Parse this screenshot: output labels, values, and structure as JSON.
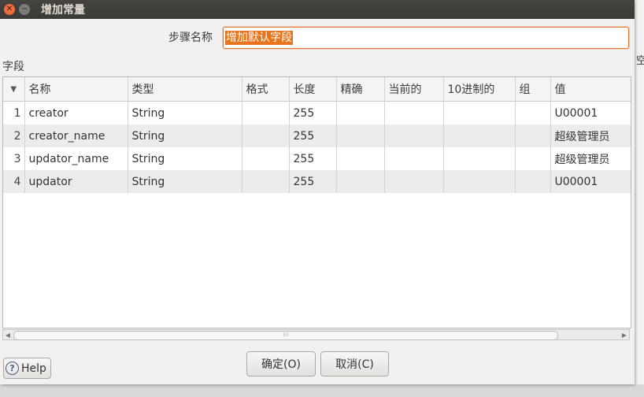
{
  "window": {
    "title": "增加常量"
  },
  "background": {
    "peek_text": "空"
  },
  "step": {
    "label": "步骤名称",
    "value": "增加默认字段"
  },
  "fields": {
    "label": "字段",
    "columns": [
      "名称",
      "类型",
      "格式",
      "长度",
      "精确",
      "当前的",
      "10进制的",
      "组",
      "值"
    ],
    "rows": [
      {
        "num": "1",
        "name": "creator",
        "type": "String",
        "format": "",
        "length": "255",
        "precision": "",
        "currency": "",
        "decimal": "",
        "group": "",
        "value": "U00001"
      },
      {
        "num": "2",
        "name": "creator_name",
        "type": "String",
        "format": "",
        "length": "255",
        "precision": "",
        "currency": "",
        "decimal": "",
        "group": "",
        "value": "超级管理员"
      },
      {
        "num": "3",
        "name": "updator_name",
        "type": "String",
        "format": "",
        "length": "255",
        "precision": "",
        "currency": "",
        "decimal": "",
        "group": "",
        "value": "超级管理员"
      },
      {
        "num": "4",
        "name": "updator",
        "type": "String",
        "format": "",
        "length": "255",
        "precision": "",
        "currency": "",
        "decimal": "",
        "group": "",
        "value": "U00001"
      }
    ]
  },
  "buttons": {
    "ok": "确定(O)",
    "cancel": "取消(C)",
    "help": "Help"
  },
  "colors": {
    "accent": "#e8741c",
    "titlebar": "#3b3a36",
    "close": "#ef6c3c"
  }
}
